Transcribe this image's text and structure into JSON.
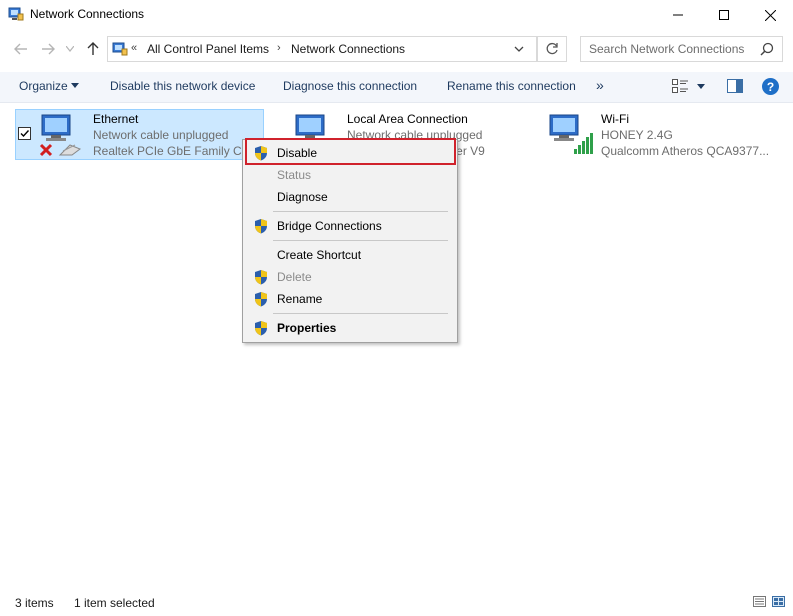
{
  "window": {
    "title": "Network Connections"
  },
  "address": {
    "separator": "«",
    "crumbs": [
      "All Control Panel Items",
      "Network Connections"
    ],
    "crumb_separator": "›",
    "search_placeholder": "Search Network Connections"
  },
  "commands": {
    "organize": "Organize",
    "disable": "Disable this network device",
    "diagnose": "Diagnose this connection",
    "rename": "Rename this connection",
    "more": "»",
    "help": "?"
  },
  "items": [
    {
      "name": "Ethernet",
      "status": "Network cable unplugged",
      "device": "Realtek PCIe GbE Family Controller",
      "selected": true,
      "checked": true
    },
    {
      "name": "Local Area Connection",
      "status": "Network cable unplugged",
      "device": "TAP-Windows Adapter V9",
      "selected": false
    },
    {
      "name": "Wi-Fi",
      "status": "HONEY 2.4G",
      "device": "Qualcomm Atheros QCA9377...",
      "selected": false
    }
  ],
  "context_menu": {
    "items": [
      {
        "label": "Disable",
        "shield": true,
        "enabled": true,
        "highlighted": true
      },
      {
        "label": "Status",
        "shield": false,
        "enabled": false
      },
      {
        "label": "Diagnose",
        "shield": false,
        "enabled": true
      },
      {
        "label": "Bridge Connections",
        "shield": true,
        "enabled": true
      },
      {
        "label": "Create Shortcut",
        "shield": false,
        "enabled": true
      },
      {
        "label": "Delete",
        "shield": true,
        "enabled": false
      },
      {
        "label": "Rename",
        "shield": true,
        "enabled": true
      },
      {
        "label": "Properties",
        "shield": true,
        "enabled": true,
        "bold": true
      }
    ]
  },
  "statusbar": {
    "count": "3 items",
    "selected": "1 item selected"
  },
  "colors": {
    "accent": "#1f6fc7",
    "selection_bg": "#cce8ff",
    "highlight_border": "#d0222c"
  }
}
